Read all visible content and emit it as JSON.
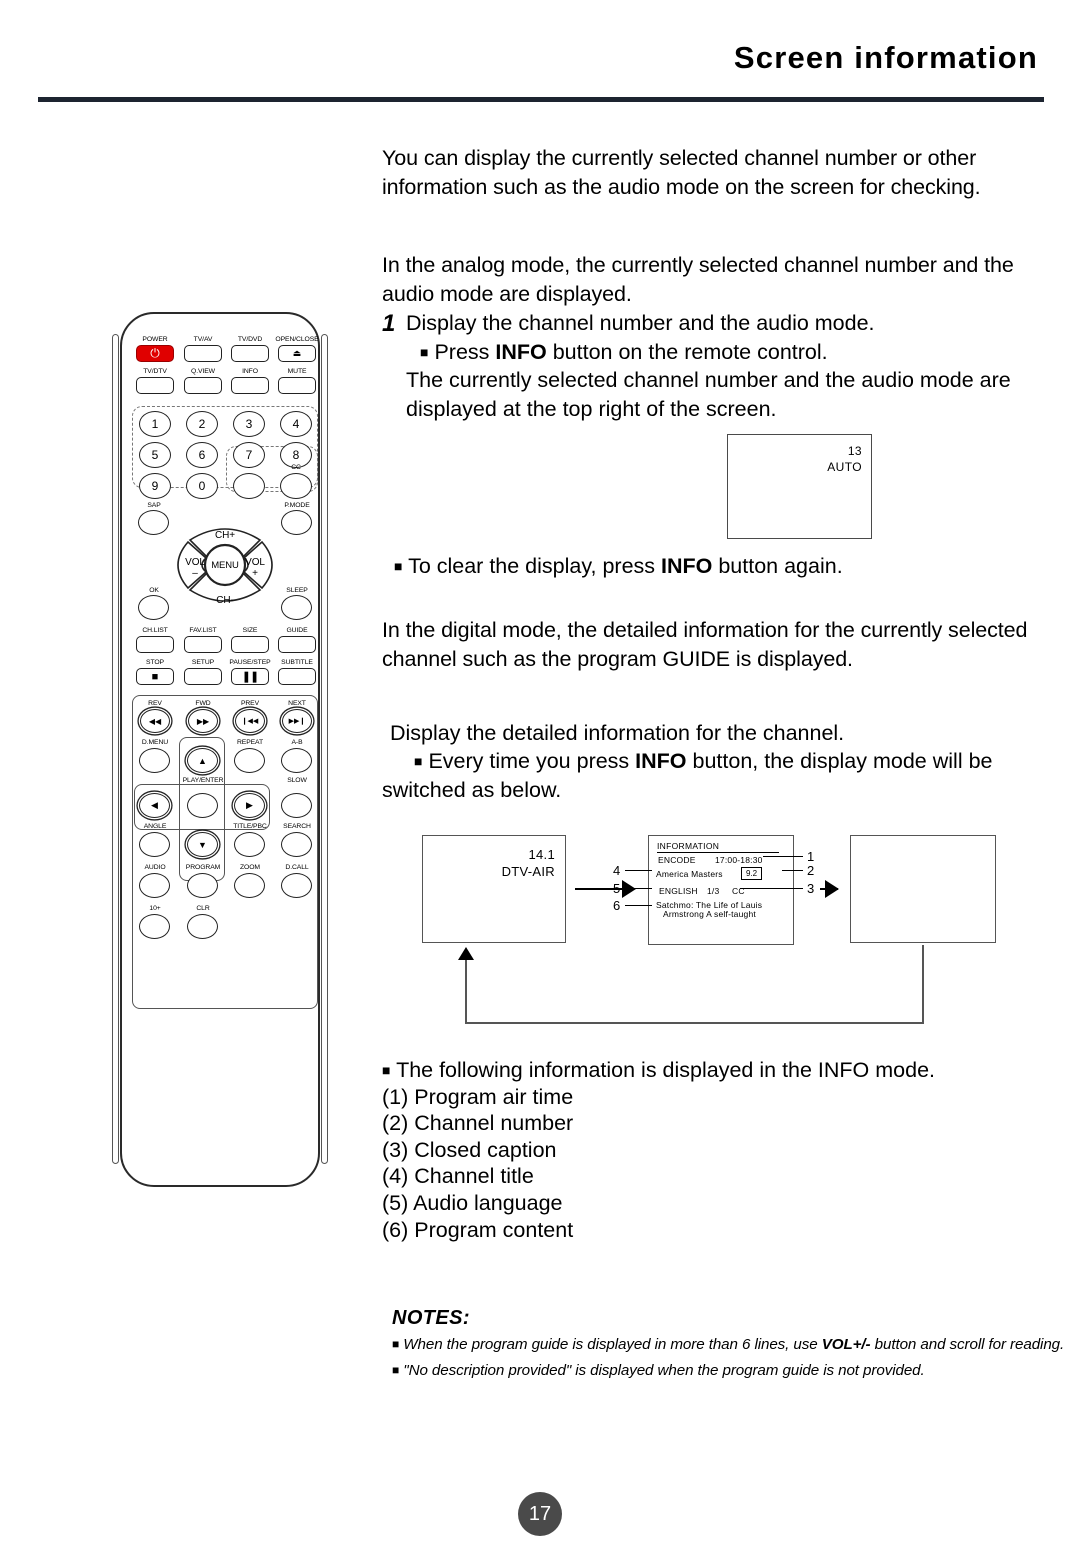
{
  "header": {
    "title": "Screen information"
  },
  "body": {
    "intro": "You can display the currently selected channel number or other information such as the audio mode on the screen for checking.",
    "analog_mode": "In the analog mode, the currently selected channel number and the audio mode are displayed.",
    "step_number": "1",
    "step_line1": "Display the channel number and the audio mode.",
    "step_bullet_pre": "Press ",
    "step_bullet_bold": "INFO",
    "step_bullet_post": " button on the remote control.",
    "step_line2": "The currently selected channel number and the audio mode are displayed at the top right of the screen.",
    "clear_pre": "To clear the display, press ",
    "clear_bold": "INFO",
    "clear_post": " button again.",
    "digital_mode": "In the digital mode, the detailed information for the currently selected channel such as the program GUIDE is displayed.",
    "display_detailed": "Display the detailed information for the channel.",
    "every_pre": "Every time you press ",
    "every_bold": "INFO",
    "every_post": " button, the display mode will be switched as below."
  },
  "analog_screen": {
    "channel": "13",
    "audio_mode": "AUTO"
  },
  "flow": {
    "box1": {
      "channel": "14.1",
      "source": "DTV-AIR"
    },
    "box2": {
      "title": "INFORMATION",
      "encode_label": "ENCODE",
      "air_time": "17:00-18:30",
      "program_title": "America Masters",
      "channel_number": "9.2",
      "audio_language": "ENGLISH",
      "page_indicator": "1/3",
      "closed_caption": "CC",
      "description_line1": "Satchmo: The Life of Lauis",
      "description_line2": "Armstrong A self-taught"
    },
    "callouts": [
      "1",
      "2",
      "3",
      "4",
      "5",
      "6"
    ]
  },
  "info_list": {
    "lead_text": "The following information is displayed in the INFO mode.",
    "items": [
      "(1) Program air time",
      "(2) Channel number",
      "(3) Closed caption",
      "(4) Channel title",
      "(5) Audio language",
      "(6) Program content"
    ]
  },
  "notes": {
    "title": "NOTES:",
    "note1_pre": "When the program guide is displayed in more than 6 lines, use ",
    "note1_bold": "VOL+/-",
    "note1_post": " button and scroll for reading.",
    "note2": "\"No description provided\" is displayed when the program guide is not provided."
  },
  "page_number": "17",
  "remote": {
    "row_power": [
      "POWER",
      "TV/AV",
      "TV/DVD",
      "OPEN/CLOSE"
    ],
    "row_tvdtv": [
      "TV/DTV",
      "Q.VIEW",
      "INFO",
      "MUTE"
    ],
    "numbers": [
      "1",
      "2",
      "3",
      "4",
      "5",
      "6",
      "7",
      "8",
      "9",
      "0"
    ],
    "dash_label": "-",
    "cc_label": "CC",
    "sap_label": "SAP",
    "pmode_label": "P.MODE",
    "nav": {
      "ch_up": "CH+",
      "ch_down": "CH-",
      "vol_down_top": "VOL",
      "vol_down_sign": "–",
      "vol_up_top": "VOL",
      "vol_up_sign": "+",
      "menu": "MENU"
    },
    "ok_label": "OK",
    "sleep_label": "SLEEP",
    "row_chlist": [
      "CH.LIST",
      "FAV.LIST",
      "SIZE",
      "GUIDE"
    ],
    "row_stop": [
      "STOP",
      "SETUP",
      "PAUSE/STEP",
      "SUBTITLE"
    ],
    "row_transport": [
      "REV",
      "FWD",
      "PREV",
      "NEXT"
    ],
    "row_dmenu": [
      "D.MENU",
      "REPEAT",
      "A-B"
    ],
    "playenter_label": "PLAY/ENTER",
    "slow_label": "SLOW",
    "row_angle": [
      "ANGLE",
      "TITLE/PBC",
      "SEARCH"
    ],
    "row_audio": [
      "AUDIO",
      "PROGRAM",
      "ZOOM",
      "D.CALL"
    ],
    "row_last": [
      "10+",
      "CLR"
    ]
  }
}
